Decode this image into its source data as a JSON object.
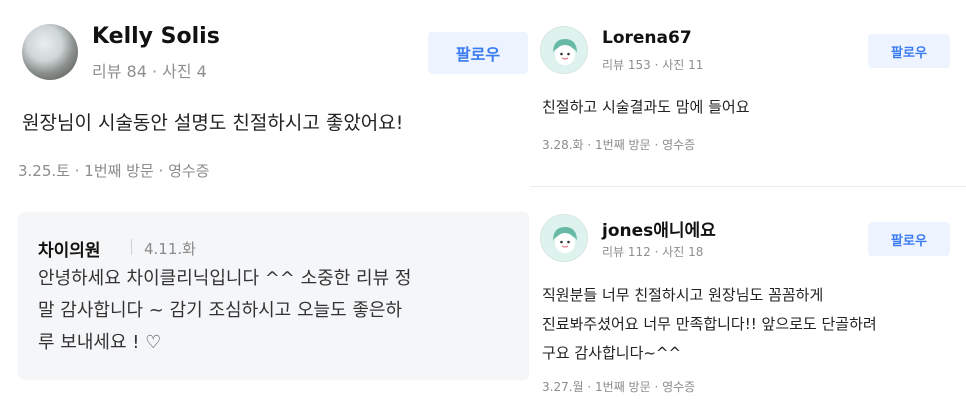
{
  "reviews_left": {
    "user": {
      "name": "Kelly Solis",
      "stats": "리뷰 84 · 사진 4"
    },
    "follow_label": "팔로우",
    "content": "원장님이 시술동안 설명도 친절하시고 좋았어요!",
    "visit_info": "3.25.토 · 1번째 방문 · 영수증",
    "reply": {
      "author": "차이의원",
      "date": "4.11.화",
      "lines": [
        "안녕하세요 차이클리닉입니다 ^^ 소중한 리뷰 정",
        "말 감사합니다 ~ 감기 조심하시고 오늘도 좋은하",
        "루 보내세요 ! ♡"
      ]
    }
  },
  "reviews_right": [
    {
      "user": {
        "name": "Lorena67",
        "stats": "리뷰 153 · 사진 11"
      },
      "follow_label": "팔로우",
      "content_lines": [
        "친절하고 시술결과도 맘에 들어요"
      ],
      "visit_info": "3.28.화 · 1번째 방문 · 영수증"
    },
    {
      "user": {
        "name": "jones애니에요",
        "stats": "리뷰 112 · 사진 18"
      },
      "follow_label": "팔로우",
      "content_lines": [
        "직원분들 너무 친절하시고 원장님도 꼼꼼하게",
        "진료봐주셨어요 너무 만족합니다!! 앞으로도 단골하려",
        "구요 감사합니다~^^"
      ],
      "visit_info": "3.27.월 · 1번째 방문 · 영수증"
    }
  ],
  "colors": {
    "follow_bg": "#edf4ff",
    "follow_text": "#3a7bf0",
    "reply_bg": "#f5f6f8"
  }
}
